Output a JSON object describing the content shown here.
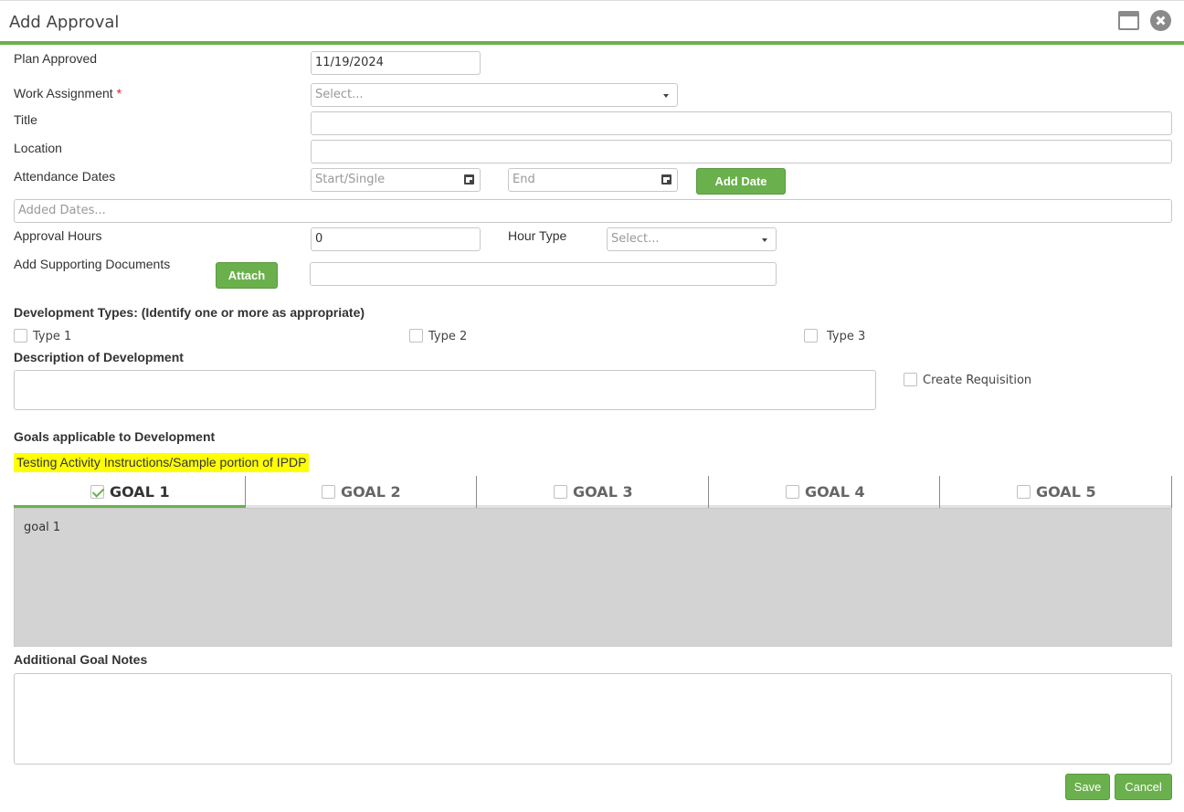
{
  "dialog": {
    "title": "Add Approval"
  },
  "form": {
    "plan_approved": {
      "label": "Plan Approved",
      "value": "11/19/2024"
    },
    "work_assignment": {
      "label": "Work Assignment",
      "required_mark": "*",
      "placeholder": "Select..."
    },
    "title": {
      "label": "Title",
      "value": ""
    },
    "location": {
      "label": "Location",
      "value": ""
    },
    "attendance_dates": {
      "label": "Attendance Dates",
      "start_placeholder": "Start/Single",
      "end_placeholder": "End",
      "add_button": "Add Date"
    },
    "added_dates": {
      "placeholder": "Added Dates..."
    },
    "approval_hours": {
      "label": "Approval Hours",
      "value": "0"
    },
    "hour_type": {
      "label": "Hour Type",
      "placeholder": "Select..."
    },
    "supporting_docs": {
      "label": "Add Supporting Documents",
      "attach_button": "Attach",
      "value": ""
    }
  },
  "development_types": {
    "heading": "Development Types: (Identify one or more as appropriate)",
    "options": [
      {
        "label": "Type 1",
        "checked": false
      },
      {
        "label": "Type 2",
        "checked": false
      },
      {
        "label": "Type 3",
        "checked": false
      }
    ]
  },
  "description": {
    "heading": "Description of Development",
    "value": "",
    "create_requisition": {
      "label": "Create Requisition",
      "checked": false
    }
  },
  "goals": {
    "heading": "Goals applicable to Development",
    "instructions": "Testing Activity Instructions/Sample portion of IPDP",
    "tabs": [
      {
        "label": "GOAL 1",
        "checked": true,
        "active": true
      },
      {
        "label": "GOAL 2",
        "checked": false,
        "active": false
      },
      {
        "label": "GOAL 3",
        "checked": false,
        "active": false
      },
      {
        "label": "GOAL 4",
        "checked": false,
        "active": false
      },
      {
        "label": "GOAL 5",
        "checked": false,
        "active": false
      }
    ],
    "active_content": "goal 1"
  },
  "notes": {
    "heading": "Additional Goal Notes",
    "value": ""
  },
  "footer": {
    "save_label": "Save",
    "cancel_label": "Cancel"
  },
  "colors": {
    "accent": "#6ab04c",
    "highlight": "#ffff00",
    "required": "#e02424",
    "goal_panel": "#d3d3d3"
  }
}
